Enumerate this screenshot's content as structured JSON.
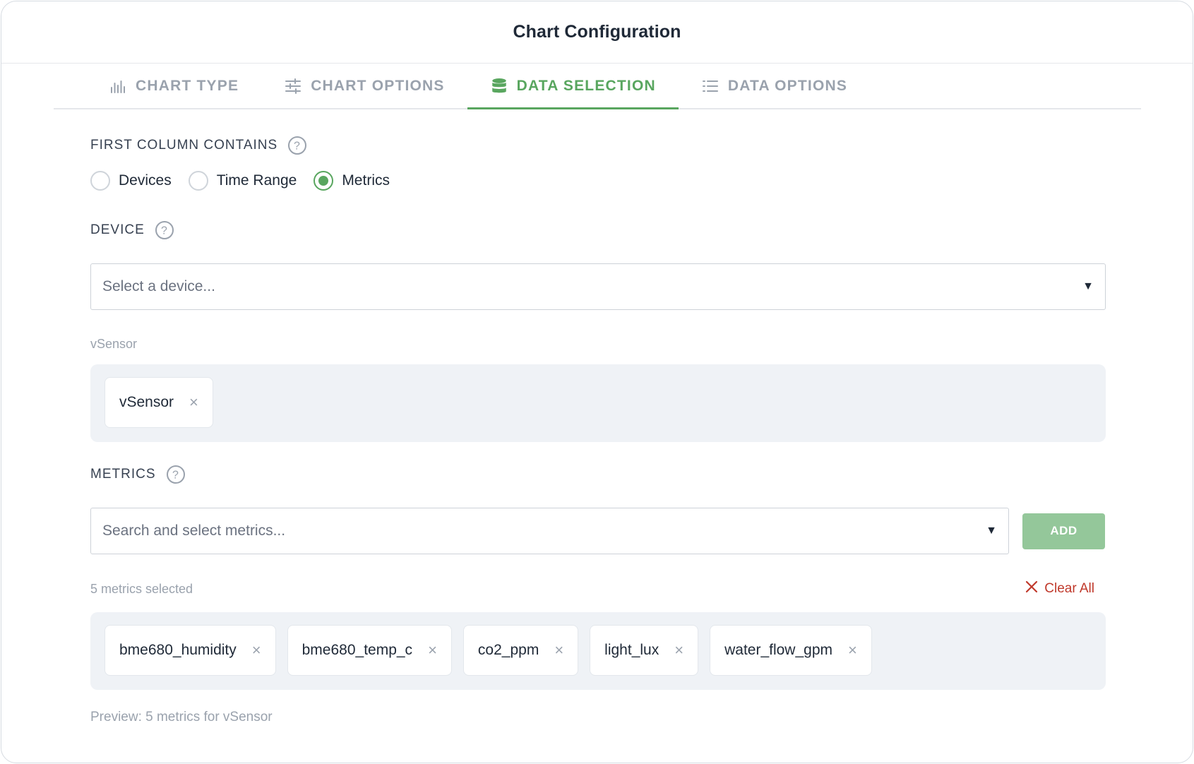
{
  "dialog": {
    "title": "Chart Configuration"
  },
  "tabs": [
    {
      "label": "CHART TYPE",
      "icon": "bar-chart-icon"
    },
    {
      "label": "CHART OPTIONS",
      "icon": "sliders-icon"
    },
    {
      "label": "DATA SELECTION",
      "icon": "database-icon",
      "active": true
    },
    {
      "label": "DATA OPTIONS",
      "icon": "list-icon"
    }
  ],
  "first_column": {
    "label": "FIRST COLUMN CONTAINS",
    "options": [
      "Devices",
      "Time Range",
      "Metrics"
    ],
    "selected": "Metrics"
  },
  "device": {
    "label": "DEVICE",
    "placeholder": "Select a device...",
    "selected_caption": "vSensor",
    "chips": [
      "vSensor"
    ]
  },
  "metrics": {
    "label": "METRICS",
    "placeholder": "Search and select metrics...",
    "add_label": "ADD",
    "count_text": "5 metrics selected",
    "clear_all_label": "Clear All",
    "chips": [
      "bme680_humidity",
      "bme680_temp_c",
      "co2_ppm",
      "light_lux",
      "water_flow_gpm"
    ]
  },
  "preview": {
    "text": "Preview: 5 metrics for vSensor"
  },
  "colors": {
    "accent": "#59a65f",
    "add_button": "#94c79a",
    "danger": "#c0392b",
    "muted": "#9aa2ad"
  }
}
